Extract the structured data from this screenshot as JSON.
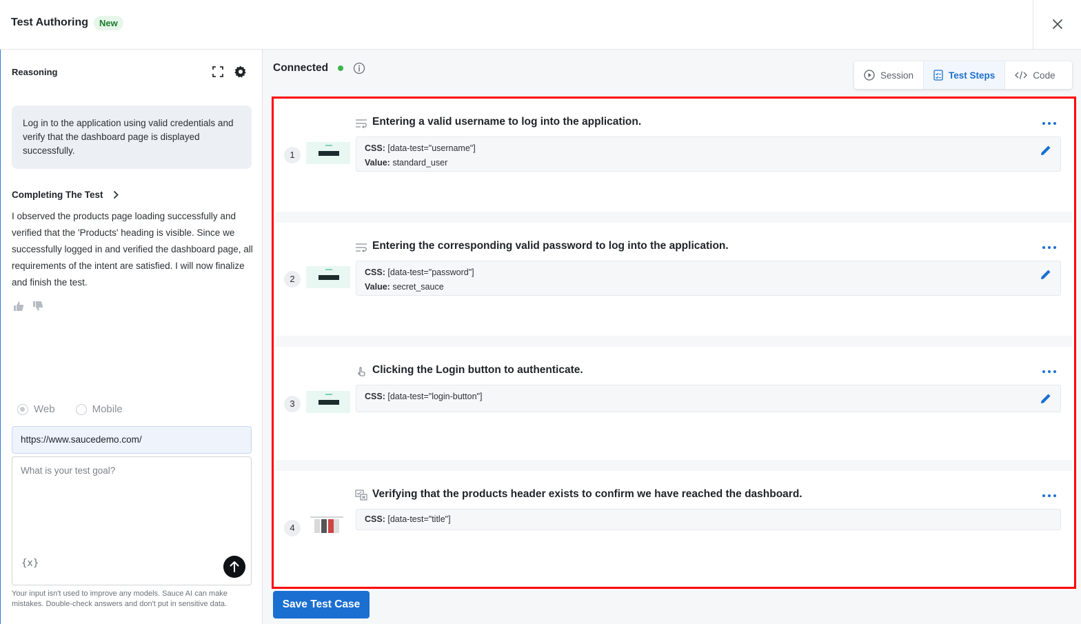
{
  "header": {
    "title": "Test Authoring",
    "badge": "New"
  },
  "left_panel": {
    "section_title": "Reasoning",
    "intent": "Log in to the application using valid credentials and verify that the dashboard page is displayed successfully.",
    "completing_title": "Completing The Test",
    "reasoning_text": "I observed the products page loading successfully and verified that the 'Products' heading is visible. Since we successfully logged in and verified the dashboard page, all requirements of the intent are satisfied. I will now finalize and finish the test.",
    "platform_options": [
      {
        "label": "Web",
        "selected": true
      },
      {
        "label": "Mobile",
        "selected": false
      }
    ],
    "url_value": "https://www.saucedemo.com/",
    "goal_placeholder": "What is your test goal?",
    "variable_button": "{x}",
    "disclaimer": "Your input isn't used to improve any models. Sauce AI can make mistakes. Double-check answers and don't put in sensitive data."
  },
  "right_panel": {
    "status": "Connected",
    "status_color": "#3cb44b",
    "tabs": [
      {
        "label": "Session",
        "icon": "play-circle-icon",
        "active": false
      },
      {
        "label": "Test Steps",
        "icon": "checklist-icon",
        "active": true
      },
      {
        "label": "Code",
        "icon": "code-icon",
        "active": false
      }
    ],
    "steps": [
      {
        "number": "1",
        "icon": "type-text-icon",
        "title": "Entering a valid username to log into the application.",
        "css_label": "CSS:",
        "css": "[data-test=\"username\"]",
        "value_label": "Value:",
        "value": "standard_user"
      },
      {
        "number": "2",
        "icon": "type-text-icon",
        "title": "Entering the corresponding valid password to log into the application.",
        "css_label": "CSS:",
        "css": "[data-test=\"password\"]",
        "value_label": "Value:",
        "value": "secret_sauce"
      },
      {
        "number": "3",
        "icon": "tap-icon",
        "title": "Clicking the Login button to authenticate.",
        "css_label": "CSS:",
        "css": "[data-test=\"login-button\"]"
      },
      {
        "number": "4",
        "icon": "verify-icon",
        "title": "Verifying that the products header exists to confirm we have reached the dashboard.",
        "css_label": "CSS:",
        "css": "[data-test=\"title\"]"
      }
    ],
    "save_button": "Save Test Case",
    "accent_color": "#1a6fd1"
  }
}
